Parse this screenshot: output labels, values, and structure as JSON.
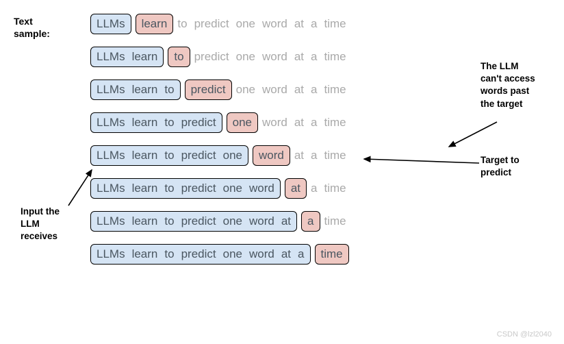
{
  "labels": {
    "text_sample": "Text\nsample:",
    "anno_input": "Input the\nLLM\nreceives",
    "anno_cant_access": "The LLM\ncan't access\nwords past\nthe target",
    "anno_target": "Target to\npredict",
    "watermark": "CSDN @lzl2040"
  },
  "words": [
    "LLMs",
    "learn",
    "to",
    "predict",
    "one",
    "word",
    "at",
    "a",
    "time"
  ],
  "rows": [
    {
      "inputEnd": 0,
      "targetIdx": 1
    },
    {
      "inputEnd": 1,
      "targetIdx": 2
    },
    {
      "inputEnd": 2,
      "targetIdx": 3
    },
    {
      "inputEnd": 3,
      "targetIdx": 4
    },
    {
      "inputEnd": 4,
      "targetIdx": 5
    },
    {
      "inputEnd": 5,
      "targetIdx": 6
    },
    {
      "inputEnd": 6,
      "targetIdx": 7
    },
    {
      "inputEnd": 7,
      "targetIdx": 8
    }
  ],
  "chart_data": {
    "type": "table",
    "description": "Autoregressive next-word prediction: each row shows increasing input context (blue) and target next word (red); words after target are inaccessible (greyed).",
    "sequence": [
      "LLMs",
      "learn",
      "to",
      "predict",
      "one",
      "word",
      "at",
      "a",
      "time"
    ],
    "examples": [
      {
        "input": [
          "LLMs"
        ],
        "target": "learn",
        "hidden": [
          "to",
          "predict",
          "one",
          "word",
          "at",
          "a",
          "time"
        ]
      },
      {
        "input": [
          "LLMs",
          "learn"
        ],
        "target": "to",
        "hidden": [
          "predict",
          "one",
          "word",
          "at",
          "a",
          "time"
        ]
      },
      {
        "input": [
          "LLMs",
          "learn",
          "to"
        ],
        "target": "predict",
        "hidden": [
          "one",
          "word",
          "at",
          "a",
          "time"
        ]
      },
      {
        "input": [
          "LLMs",
          "learn",
          "to",
          "predict"
        ],
        "target": "one",
        "hidden": [
          "word",
          "at",
          "a",
          "time"
        ]
      },
      {
        "input": [
          "LLMs",
          "learn",
          "to",
          "predict",
          "one"
        ],
        "target": "word",
        "hidden": [
          "at",
          "a",
          "time"
        ]
      },
      {
        "input": [
          "LLMs",
          "learn",
          "to",
          "predict",
          "one",
          "word"
        ],
        "target": "at",
        "hidden": [
          "a",
          "time"
        ]
      },
      {
        "input": [
          "LLMs",
          "learn",
          "to",
          "predict",
          "one",
          "word",
          "at"
        ],
        "target": "a",
        "hidden": [
          "time"
        ]
      },
      {
        "input": [
          "LLMs",
          "learn",
          "to",
          "predict",
          "one",
          "word",
          "at",
          "a"
        ],
        "target": "time",
        "hidden": []
      }
    ]
  }
}
